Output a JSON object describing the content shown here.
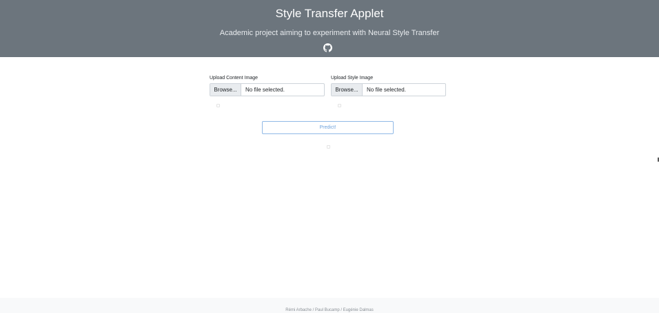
{
  "header": {
    "title": "Style Transfer Applet",
    "subtitle": "Academic project aiming to experiment with Neural Style Transfer",
    "github_icon": "github-icon"
  },
  "uploads": {
    "content": {
      "label": "Upload Content Image",
      "browse_label": "Browse...",
      "status": "No file selected."
    },
    "style": {
      "label": "Upload Style Image",
      "browse_label": "Browse...",
      "status": "No file selected."
    }
  },
  "predict": {
    "label": "Predict!"
  },
  "footer": {
    "credits": "Rémi Arbache / Paul Bucamp / Eugénie Dalmas"
  },
  "colors": {
    "header_bg": "#6c757d",
    "predict_border": "#90b9e6",
    "predict_text": "#6fa3dc"
  }
}
